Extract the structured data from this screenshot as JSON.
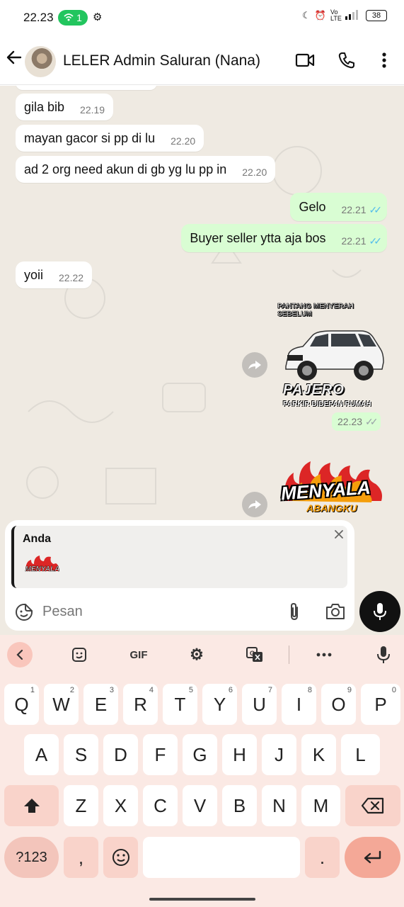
{
  "status_bar": {
    "time": "22.23",
    "hotspot_count": "1",
    "battery": "38",
    "network_label": "Vo LTE"
  },
  "header": {
    "title": "LELER Admin Saluran (Nana)"
  },
  "messages": [
    {
      "side": "in",
      "text": "gila bib",
      "time": "22.19"
    },
    {
      "side": "in",
      "text": "mayan gacor si pp di lu",
      "time": "22.20"
    },
    {
      "side": "in",
      "text": "ad 2 org need akun di gb yg lu pp in",
      "time": "22.20"
    },
    {
      "side": "out",
      "text": "Gelo",
      "time": "22.21",
      "status": "read"
    },
    {
      "side": "out",
      "text": "Buyer seller ytta aja bos",
      "time": "22.21",
      "status": "read"
    },
    {
      "side": "in",
      "text": "yoii",
      "time": "22.22"
    }
  ],
  "stickers": [
    {
      "top_text": "PANTANG MENYERAH SEBELUM",
      "brand_text": "PAJERO",
      "bottom_text": "PARKIR DIDEPAN RUMAH",
      "time": "22.23",
      "status": "delivered"
    },
    {
      "main_text": "MENYALA",
      "sub_text": "ABANGKU"
    }
  ],
  "reply": {
    "author": "Anda",
    "thumb_text": "MENYALA"
  },
  "composer": {
    "placeholder": "Pesan"
  },
  "keyboard": {
    "toolbar": {
      "gif": "GIF"
    },
    "row1": [
      {
        "key": "Q",
        "hint": "1"
      },
      {
        "key": "W",
        "hint": "2"
      },
      {
        "key": "E",
        "hint": "3"
      },
      {
        "key": "R",
        "hint": "4"
      },
      {
        "key": "T",
        "hint": "5"
      },
      {
        "key": "Y",
        "hint": "6"
      },
      {
        "key": "U",
        "hint": "7"
      },
      {
        "key": "I",
        "hint": "8"
      },
      {
        "key": "O",
        "hint": "9"
      },
      {
        "key": "P",
        "hint": "0"
      }
    ],
    "row2": [
      "A",
      "S",
      "D",
      "F",
      "G",
      "H",
      "J",
      "K",
      "L"
    ],
    "row3": [
      "Z",
      "X",
      "C",
      "V",
      "B",
      "N",
      "M"
    ],
    "row4": {
      "symbols": "?123",
      "comma": ",",
      "period": "."
    }
  },
  "colors": {
    "chat_bg": "#efeae2",
    "outgoing_bubble": "#d9fdd3",
    "incoming_bubble": "#ffffff",
    "read_tick": "#53bdeb",
    "keyboard_bg": "#fbe9e4",
    "keyboard_accent": "#f4a897"
  }
}
